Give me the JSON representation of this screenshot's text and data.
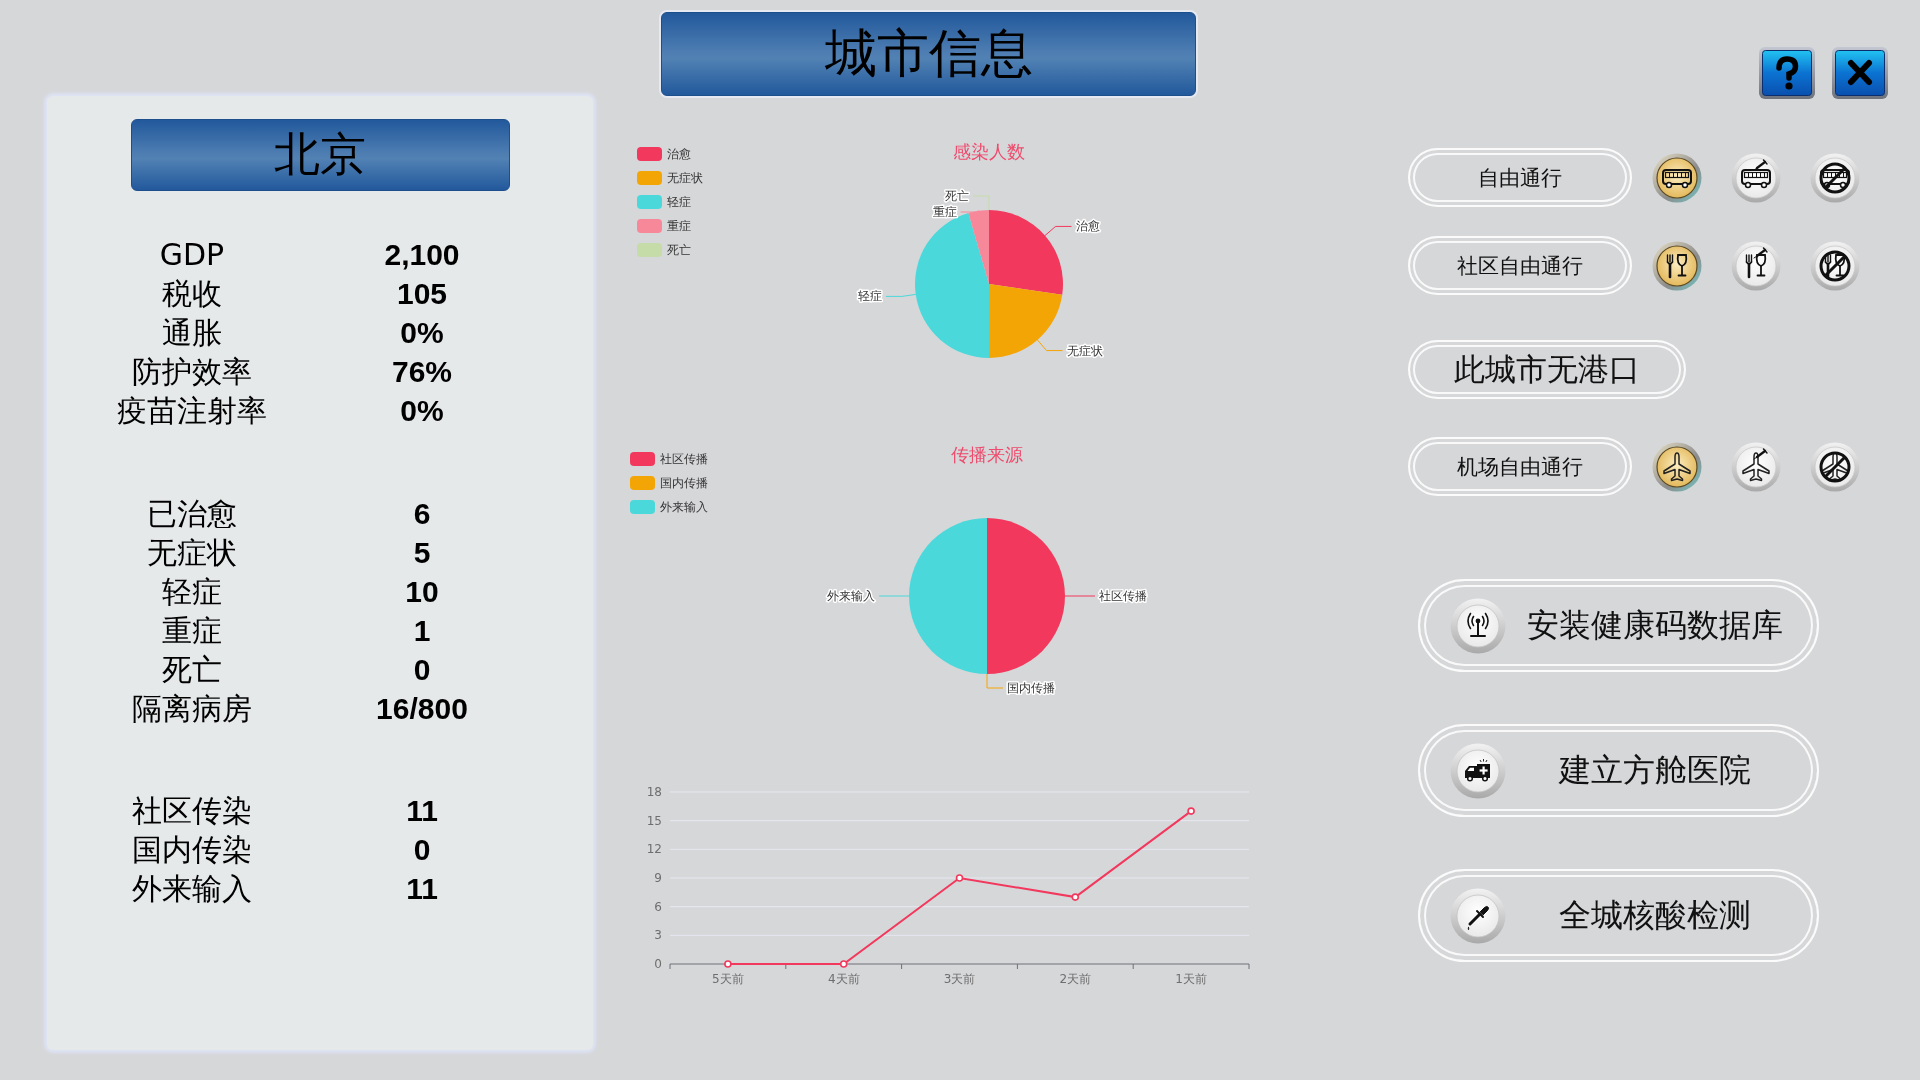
{
  "title": "城市信息",
  "city_panel": {
    "city": "北京",
    "stat_groups": [
      [
        {
          "label": "GDP",
          "value": "2,100"
        },
        {
          "label": "税收",
          "value": "105"
        },
        {
          "label": "通胀",
          "value": "0%"
        },
        {
          "label": "防护效率",
          "value": "76%"
        },
        {
          "label": "疫苗注射率",
          "value": "0%"
        }
      ],
      [
        {
          "label": "已治愈",
          "value": "6"
        },
        {
          "label": "无症状",
          "value": "5"
        },
        {
          "label": "轻症",
          "value": "10"
        },
        {
          "label": "重症",
          "value": "1"
        },
        {
          "label": "死亡",
          "value": "0"
        },
        {
          "label": "隔离病房",
          "value": "16/800"
        }
      ],
      [
        {
          "label": "社区传染",
          "value": "11"
        },
        {
          "label": "国内传染",
          "value": "0"
        },
        {
          "label": "外来输入",
          "value": "11"
        }
      ]
    ]
  },
  "charts": {
    "infection": {
      "legend": [
        {
          "label": "治愈",
          "color": "#f2385c"
        },
        {
          "label": "无症状",
          "color": "#f4a506"
        },
        {
          "label": "轻症",
          "color": "#4bd8da"
        },
        {
          "label": "重症",
          "color": "#f7889a"
        },
        {
          "label": "死亡",
          "color": "#c5dba8"
        }
      ],
      "chart_data": {
        "type": "pie",
        "title": "感染人数",
        "categories": [
          "治愈",
          "无症状",
          "轻症",
          "重症",
          "死亡"
        ],
        "values": [
          27.3,
          22.7,
          45.5,
          4.5,
          0
        ]
      }
    },
    "source": {
      "legend": [
        {
          "label": "社区传播",
          "color": "#f2385c"
        },
        {
          "label": "国内传播",
          "color": "#f4a506"
        },
        {
          "label": "外来输入",
          "color": "#4bd8da"
        }
      ],
      "chart_data": {
        "type": "pie",
        "title": "传播来源",
        "categories": [
          "社区传播",
          "国内传播",
          "外来输入"
        ],
        "values": [
          50,
          0,
          50
        ]
      }
    },
    "trend": {
      "chart_data": {
        "type": "line",
        "categories": [
          "5天前",
          "4天前",
          "3天前",
          "2天前",
          "1天前"
        ],
        "series": [
          {
            "color": "#f2385c",
            "marker": "circle",
            "values": [
              0,
              0,
              9,
              7,
              16
            ]
          }
        ],
        "ylim": [
          0,
          18
        ],
        "yticks": [
          0,
          3,
          6,
          9,
          12,
          15,
          18
        ],
        "grid": true
      }
    }
  },
  "pass_rules": [
    {
      "kind": "bus",
      "label": "自由通行",
      "options": [
        {
          "kind": "free",
          "selected": true
        },
        {
          "kind": "vaccinated",
          "selected": false
        },
        {
          "kind": "banned",
          "selected": false
        }
      ]
    },
    {
      "kind": "dining",
      "label": "社区自由通行",
      "options": [
        {
          "kind": "free",
          "selected": true
        },
        {
          "kind": "vaccinated",
          "selected": false
        },
        {
          "kind": "banned",
          "selected": false
        }
      ]
    },
    {
      "kind": "port",
      "label": "此城市无港口"
    },
    {
      "kind": "airport",
      "label": "机场自由通行",
      "options": [
        {
          "kind": "free",
          "selected": true
        },
        {
          "kind": "vaccinated",
          "selected": false
        },
        {
          "kind": "banned",
          "selected": false
        }
      ]
    }
  ],
  "actions": [
    {
      "kind": "health_code",
      "label": "安装健康码数据库"
    },
    {
      "kind": "field_hospital",
      "label": "建立方舱医院"
    },
    {
      "kind": "nucleic_test",
      "label": "全城核酸检测"
    }
  ]
}
